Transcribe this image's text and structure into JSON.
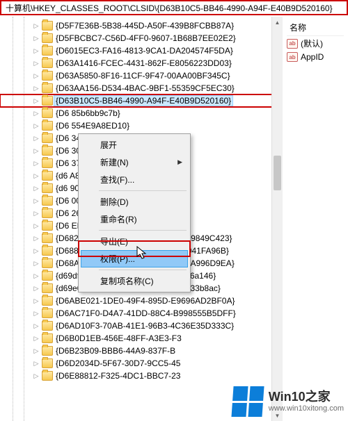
{
  "address_bar": "十算机\\HKEY_CLASSES_ROOT\\CLSID\\{D63B10C5-BB46-4990-A94F-E40B9D520160}",
  "tree_items": [
    {
      "label": "{D5F7E36B-5B38-445D-A50F-439B8FCBB87A}",
      "selected": false,
      "highlighted": false
    },
    {
      "label": "{D5FBCBC7-C56D-4FF0-9607-1B68B7EE02E2}",
      "selected": false,
      "highlighted": false
    },
    {
      "label": "{D6015EC3-FA16-4813-9CA1-DA204574F5DA}",
      "selected": false,
      "highlighted": false
    },
    {
      "label": "{D63A1416-FCEC-4431-862F-E8056223DD03}",
      "selected": false,
      "highlighted": false
    },
    {
      "label": "{D63A5850-8F16-11CF-9F47-00AA00BF345C}",
      "selected": false,
      "highlighted": false
    },
    {
      "label": "{D63AA156-D534-4BAC-9BF1-55359CF5EC30}",
      "selected": false,
      "highlighted": false
    },
    {
      "label": "{D63B10C5-BB46-4990-A94F-E40B9D520160}",
      "selected": true,
      "highlighted": true
    },
    {
      "label": "{D6                                  85b6bb9c7b}",
      "selected": false,
      "highlighted": false
    },
    {
      "label": "{D6                                  554E9A8ED10}",
      "selected": false,
      "highlighted": false
    },
    {
      "label": "{D6                                  34BD2B25A23}",
      "selected": false,
      "highlighted": false
    },
    {
      "label": "{D6                                  301CB439E30}",
      "selected": false,
      "highlighted": false
    },
    {
      "label": "{D6                                  3733558C381}",
      "selected": false,
      "highlighted": false
    },
    {
      "label": "{d6                                  A85382BE9C1}",
      "selected": false,
      "highlighted": false
    },
    {
      "label": "{d6                                  90743ee2ff}",
      "selected": false,
      "highlighted": false
    },
    {
      "label": "{D6                                  00C04FC9B31F}",
      "selected": false,
      "highlighted": false
    },
    {
      "label": "{D6                                  268524D1B7B4}",
      "selected": false,
      "highlighted": false
    },
    {
      "label": "{D6                                  ED8E86E9B8}",
      "selected": false,
      "highlighted": false
    },
    {
      "label": "{D682C4BA-A90A-42FE-B9E1-03109849C423}",
      "selected": false,
      "highlighted": false
    },
    {
      "label": "{D6886603-9D2F-4EB2-B667-1971041FA96B}",
      "selected": false,
      "highlighted": false
    },
    {
      "label": "{D68AF00A-29CB-43FA-8504-CE99A996D9EA}",
      "selected": false,
      "highlighted": false
    },
    {
      "label": "{d69df9c0-ded9-4290-958f-93e82ea6a146}",
      "selected": false,
      "highlighted": false
    },
    {
      "label": "{d69e0717-dd4b-4b25-997a-da813833b8ac}",
      "selected": false,
      "highlighted": false
    },
    {
      "label": "{D6ABE021-1DE0-49F4-895D-E9696AD2BF0A}",
      "selected": false,
      "highlighted": false
    },
    {
      "label": "{D6AC71F0-D4A7-41DD-88C4-B998555B5DFF}",
      "selected": false,
      "highlighted": false
    },
    {
      "label": "{D6AD10F3-70AB-41E1-96B3-4C36E35D333C}",
      "selected": false,
      "highlighted": false
    },
    {
      "label": "{D6B0D1EB-456E-48FF-A3E3-F3",
      "selected": false,
      "highlighted": false
    },
    {
      "label": "{D6B23B09-BBB6-44A9-837F-B",
      "selected": false,
      "highlighted": false
    },
    {
      "label": "{D6D2034D-5F67-30D7-9CC5-45",
      "selected": false,
      "highlighted": false
    },
    {
      "label": "{D6E88812-F325-4DC1-BBC7-23",
      "selected": false,
      "highlighted": false
    }
  ],
  "context_menu": [
    {
      "label": "展开",
      "type": "item",
      "hover": false,
      "submenu": false,
      "disabled": false
    },
    {
      "label": "新建(N)",
      "type": "item",
      "hover": false,
      "submenu": true,
      "disabled": false
    },
    {
      "label": "查找(F)...",
      "type": "item",
      "hover": false,
      "submenu": false,
      "disabled": false
    },
    {
      "type": "sep"
    },
    {
      "label": "删除(D)",
      "type": "item",
      "hover": false,
      "submenu": false,
      "disabled": false
    },
    {
      "label": "重命名(R)",
      "type": "item",
      "hover": false,
      "submenu": false,
      "disabled": false
    },
    {
      "type": "sep"
    },
    {
      "label": "导出(E)",
      "type": "item",
      "hover": false,
      "submenu": false,
      "disabled": false
    },
    {
      "label": "权限(P)...",
      "type": "item",
      "hover": true,
      "submenu": false,
      "disabled": false
    },
    {
      "type": "sep"
    },
    {
      "label": "复制项名称(C)",
      "type": "item",
      "hover": false,
      "submenu": false,
      "disabled": false
    }
  ],
  "right_pane": {
    "column_header": "名称",
    "values": [
      {
        "icon": "ab",
        "name": "(默认)"
      },
      {
        "icon": "ab",
        "name": "AppID"
      }
    ]
  },
  "watermark": {
    "title": "Win10之家",
    "url": "www.win10xitong.com"
  }
}
